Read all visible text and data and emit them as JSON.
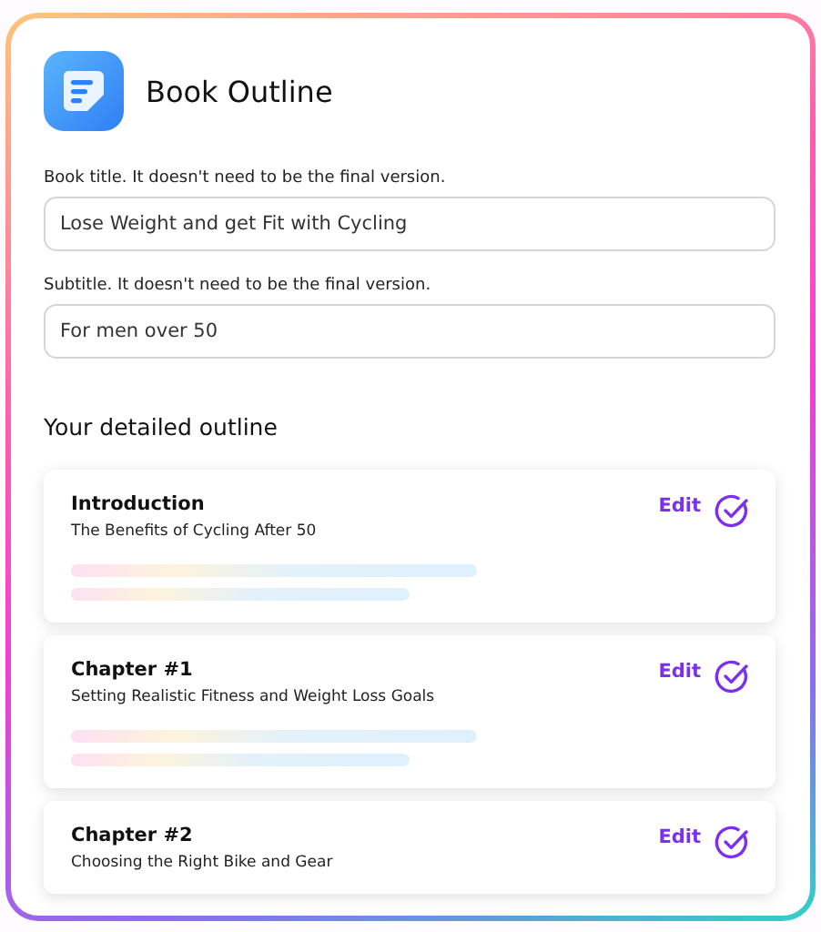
{
  "header": {
    "title": "Book Outline"
  },
  "fields": [
    {
      "label": "Book title. It doesn't need to be the final version.",
      "value": "Lose Weight and get Fit with Cycling"
    },
    {
      "label": "Subtitle. It doesn't need to be the final version.",
      "value": "For men over 50"
    }
  ],
  "outline": {
    "heading": "Your detailed outline",
    "sections": [
      {
        "title": "Introduction",
        "subtitle": "The Benefits of Cycling After 50",
        "edit_label": "Edit",
        "loading": true
      },
      {
        "title": "Chapter #1",
        "subtitle": "Setting Realistic Fitness and Weight Loss Goals",
        "edit_label": "Edit",
        "loading": true
      },
      {
        "title": "Chapter #2",
        "subtitle": "Choosing the Right Bike and Gear",
        "edit_label": "Edit",
        "loading": false
      }
    ]
  }
}
